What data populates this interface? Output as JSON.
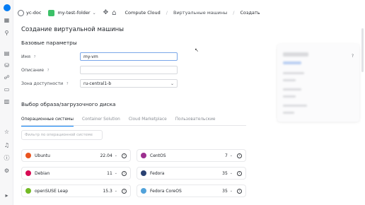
{
  "topbar": {
    "org": "yc-doc",
    "folder": "my-test-folder",
    "breadcrumbs": [
      "Compute Cloud",
      "Виртуальные машины",
      "Создать"
    ]
  },
  "page_title": "Создание виртуальной машины",
  "basic": {
    "title": "Базовые параметры",
    "name_label": "Имя",
    "name_value": "my-vm",
    "description_label": "Описание",
    "description_value": "",
    "zone_label": "Зона доступности",
    "zone_value": "ru-central1-b"
  },
  "image": {
    "title": "Выбор образа/загрузочного диска",
    "tabs": [
      "Операционные системы",
      "Container Solution",
      "Cloud Marketplace",
      "Пользовательские"
    ],
    "search_placeholder": "Фильтр по операционной системе",
    "cards": [
      {
        "name": "Ubuntu",
        "version": "22.04",
        "icon": "ubuntu-icon",
        "color": "#e95420"
      },
      {
        "name": "CentOS",
        "version": "7",
        "icon": "centos-icon",
        "color": "#9c2f8f"
      },
      {
        "name": "Debian",
        "version": "11",
        "icon": "debian-icon",
        "color": "#d70a53"
      },
      {
        "name": "Fedora",
        "version": "35",
        "icon": "fedora-icon",
        "color": "#294172"
      },
      {
        "name": "openSUSE Leap",
        "version": "15.3",
        "icon": "opensuse-icon",
        "color": "#73ba25"
      },
      {
        "name": "Fedora CoreOS",
        "version": "35",
        "icon": "fedora-coreos-icon",
        "color": "#51a2da"
      }
    ]
  },
  "summary": {
    "help_glyph": "?"
  },
  "colors": {
    "accent": "#027bf3",
    "folder_badge": "#3cc168"
  }
}
